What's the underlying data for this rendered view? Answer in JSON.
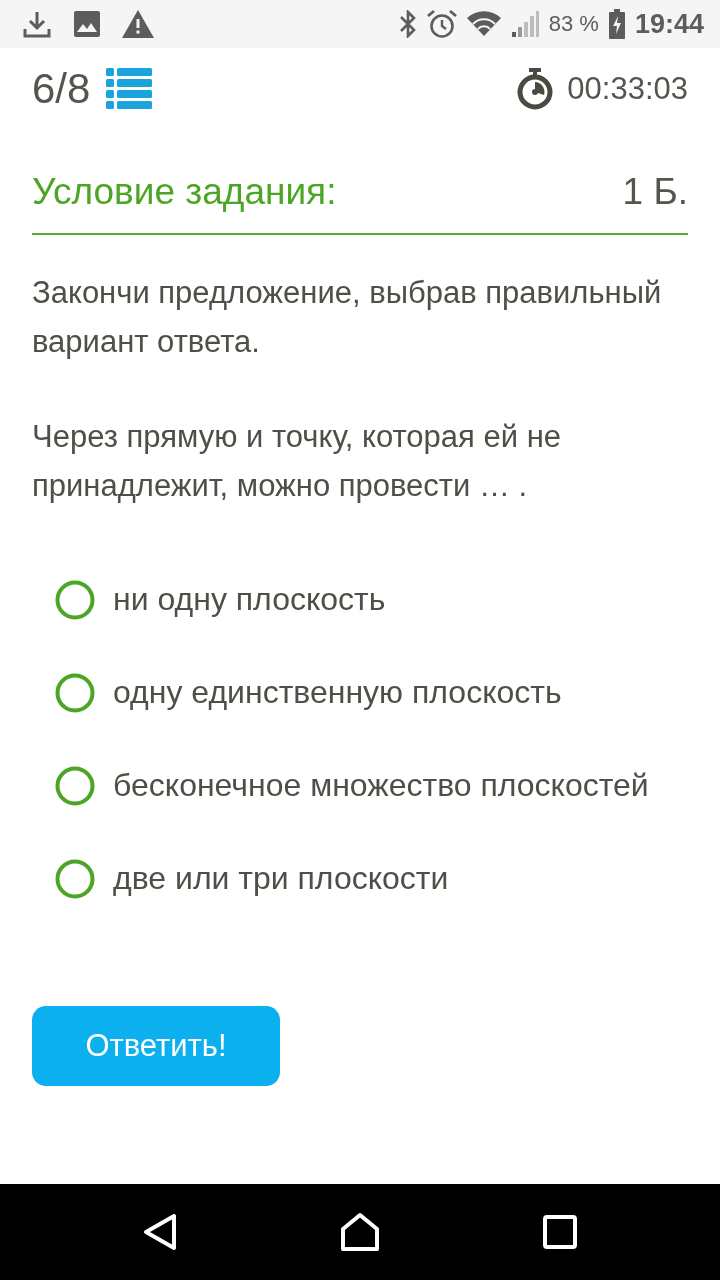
{
  "status_bar": {
    "battery": "83 %",
    "time": "19:44"
  },
  "header": {
    "counter": "6/8",
    "timer": "00:33:03"
  },
  "task": {
    "title": "Условие задания:",
    "points": "1 Б.",
    "paragraphs": [
      "Закончи предложение, выбрав правильный вариант ответа.",
      "Через прямую и точку, которая ей не принадлежит, можно провести … ."
    ]
  },
  "options": [
    {
      "label": "ни одну плоскость",
      "selected": false
    },
    {
      "label": "одну единственную плоскость",
      "selected": false
    },
    {
      "label": "бесконечное множество плоскостей",
      "selected": false
    },
    {
      "label": "две или три плоскости",
      "selected": false
    }
  ],
  "submit_button": {
    "label": "Ответить!"
  }
}
